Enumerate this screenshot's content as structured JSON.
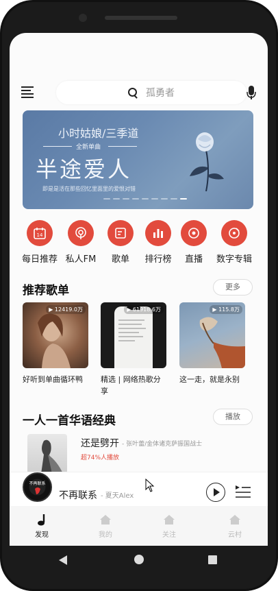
{
  "search": {
    "placeholder": "孤勇者"
  },
  "banner": {
    "subtitle": "小时姑娘/三季道",
    "tag": "全新单曲",
    "title": "半途爱人",
    "slogan": "即是是活在那些回忆里面里的爱恨对错",
    "dot_count": 9,
    "active_dot": 8
  },
  "categories": [
    {
      "label": "每日推荐",
      "icon": "calendar-icon",
      "badge": "14"
    },
    {
      "label": "私人FM",
      "icon": "radio-icon"
    },
    {
      "label": "歌单",
      "icon": "playlist-icon"
    },
    {
      "label": "排行榜",
      "icon": "chart-icon"
    },
    {
      "label": "直播",
      "icon": "live-icon"
    },
    {
      "label": "数字专辑",
      "icon": "album-icon"
    }
  ],
  "recommend": {
    "title": "推荐歌单",
    "more_label": "更多",
    "cards": [
      {
        "count": "▶ 12419.0万",
        "title": "好听到单曲循环鸭"
      },
      {
        "count": "▶ 61918.6万",
        "title": "精选 | 网络热歌分享"
      },
      {
        "count": "▶ 115.8万",
        "title": "这一走，就是永别"
      }
    ]
  },
  "classic": {
    "title": "一人一首华语经典",
    "play_label": "播放",
    "song": {
      "name": "还是劈开",
      "artist": "- 张叶蕾/金体诸克萨振国战士",
      "tag": "超74%人播放"
    }
  },
  "player": {
    "song": "不再联系",
    "artist": "- 夏天Alex"
  },
  "tabs": [
    {
      "label": "发现",
      "icon": "music-note-icon",
      "active": true
    },
    {
      "label": "我的",
      "icon": "home-icon",
      "active": false
    },
    {
      "label": "关注",
      "icon": "home-icon",
      "active": false
    },
    {
      "label": "云村",
      "icon": "home-icon",
      "active": false
    }
  ],
  "colors": {
    "accent": "#e24b3d",
    "banner": "#6a8ab2"
  }
}
